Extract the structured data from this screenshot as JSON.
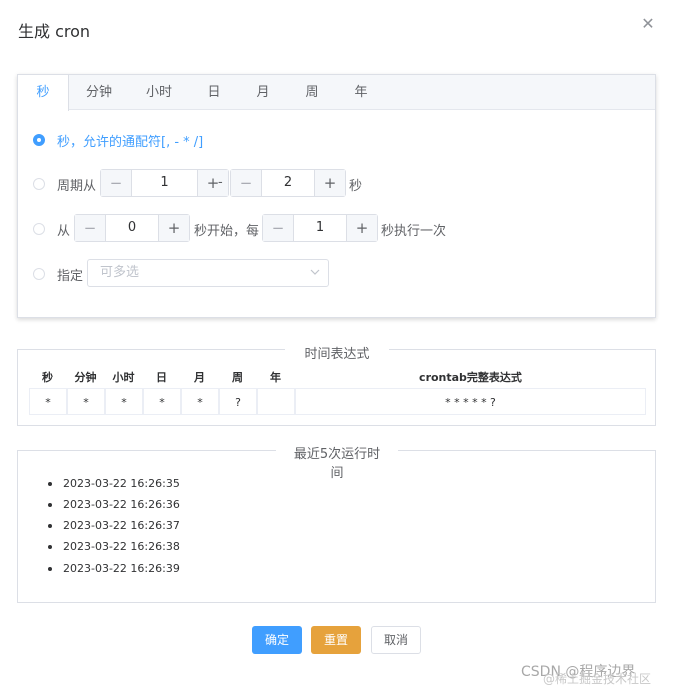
{
  "dialog": {
    "title": "生成 cron",
    "close_icon": "close-icon"
  },
  "tabs": [
    {
      "label": "秒",
      "active": true
    },
    {
      "label": "分钟"
    },
    {
      "label": "小时"
    },
    {
      "label": "日"
    },
    {
      "label": "月"
    },
    {
      "label": "周"
    },
    {
      "label": "年"
    }
  ],
  "options": {
    "any": {
      "label": "秒，允许的通配符[, - * /]",
      "selected": true
    },
    "period": {
      "prefix": "周期从",
      "dash": "-",
      "from": "1",
      "to": "2",
      "suffix": "秒"
    },
    "loop": {
      "prefix": "从",
      "start": "0",
      "middle": "秒开始，每",
      "step": "1",
      "suffix": "秒执行一次"
    },
    "specify": {
      "label": "指定",
      "placeholder": "可多选"
    }
  },
  "stepper": {
    "minus": "−",
    "plus": "+"
  },
  "expression": {
    "legend": "时间表达式",
    "headers": [
      "秒",
      "分钟",
      "小时",
      "日",
      "月",
      "周",
      "年",
      "crontab完整表达式"
    ],
    "values": [
      "*",
      "*",
      "*",
      "*",
      "*",
      "?",
      "",
      "* * * * * ?"
    ]
  },
  "recent": {
    "legend": "最近5次运行时间",
    "times": [
      "2023-03-22 16:26:35",
      "2023-03-22 16:26:36",
      "2023-03-22 16:26:37",
      "2023-03-22 16:26:38",
      "2023-03-22 16:26:39"
    ]
  },
  "footer": {
    "confirm": "确定",
    "reset": "重置",
    "cancel": "取消"
  },
  "watermark": {
    "line1": "CSDN @程序边界",
    "line2": "@稀土掘金技术社区"
  },
  "colors": {
    "primary": "#409eff",
    "warning": "#e6a23c",
    "border": "#dcdfe6"
  }
}
